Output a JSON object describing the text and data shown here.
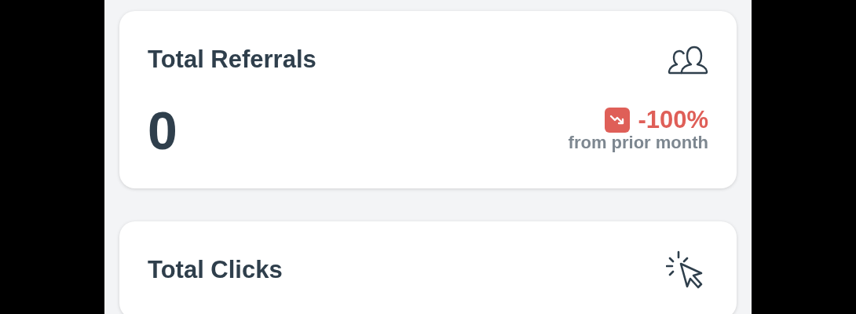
{
  "cards": [
    {
      "title": "Total Referrals",
      "kind": "people",
      "value": "0",
      "change": {
        "kind": "down",
        "text": "-100%",
        "caption": "from prior month"
      }
    },
    {
      "title": "Total Clicks",
      "kind": "click"
    }
  ]
}
